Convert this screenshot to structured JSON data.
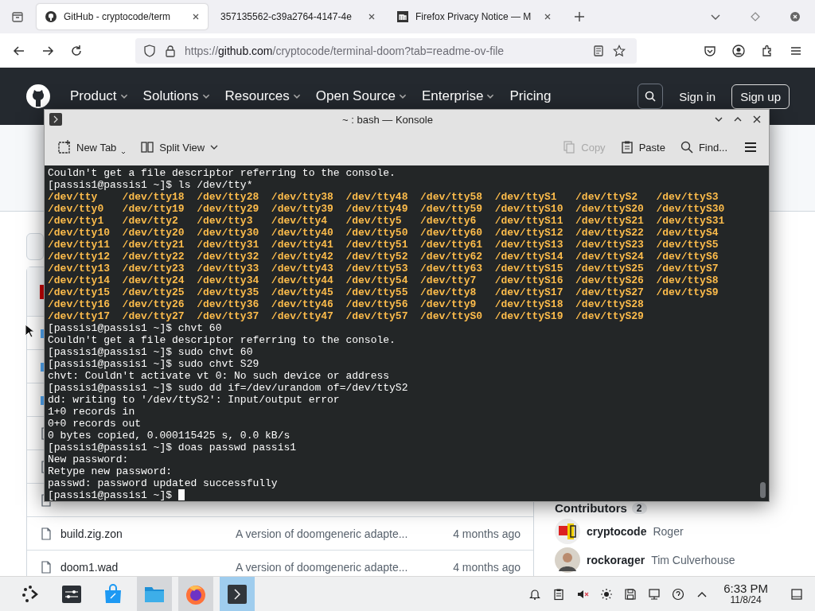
{
  "browser": {
    "tabs": [
      {
        "title": "GitHub - cryptocode/term",
        "selected": true
      },
      {
        "title": "357135562-c39a2764-4147-4e",
        "selected": false
      },
      {
        "title": "Firefox Privacy Notice — M",
        "selected": false
      }
    ],
    "url": {
      "scheme": "https://",
      "host": "github.com",
      "path": "/cryptocode/terminal-doom?tab=readme-ov-file"
    }
  },
  "github": {
    "nav": [
      {
        "label": "Product",
        "has_menu": true
      },
      {
        "label": "Solutions",
        "has_menu": true
      },
      {
        "label": "Resources",
        "has_menu": true
      },
      {
        "label": "Open Source",
        "has_menu": true
      },
      {
        "label": "Enterprise",
        "has_menu": true
      },
      {
        "label": "Pricing",
        "has_menu": false
      }
    ],
    "sign_in": "Sign in",
    "sign_up": "Sign up",
    "files": [
      {
        "kind": "avatar"
      },
      {
        "kind": "folder"
      },
      {
        "kind": "folder"
      },
      {
        "kind": "folder"
      },
      {
        "kind": "file"
      },
      {
        "kind": "file"
      },
      {
        "kind": "file"
      },
      {
        "kind": "file",
        "name": "build.zig.zon",
        "message": "A version of doomgeneric adapte...",
        "time": "4 months ago"
      },
      {
        "kind": "file",
        "name": "doom1.wad",
        "message": "A version of doomgeneric adapte...",
        "time": "4 months ago"
      }
    ],
    "contributors_title": "Contributors",
    "contributors_count": "2",
    "contributors": [
      {
        "login": "cryptocode",
        "name": "Roger"
      },
      {
        "login": "rockorager",
        "name": "Tim Culverhouse"
      }
    ]
  },
  "konsole": {
    "title": "~ : bash — Konsole",
    "toolbar": [
      {
        "label": "New Tab",
        "kind": "newtab",
        "disabled": false
      },
      {
        "label": "Split View",
        "kind": "split",
        "disabled": false
      },
      {
        "label": "Copy",
        "kind": "copy",
        "disabled": true
      },
      {
        "label": "Paste",
        "kind": "paste",
        "disabled": false
      },
      {
        "label": "Find...",
        "kind": "find",
        "disabled": false
      }
    ],
    "lines": [
      {
        "kind": "text",
        "text": "Couldn't get a file descriptor referring to the console."
      },
      {
        "kind": "text",
        "text": "[passis1@passis1 ~]$ ls /dev/tty*"
      },
      {
        "kind": "listing",
        "entries": [
          "/dev/tty",
          "/dev/tty18",
          "/dev/tty28",
          "/dev/tty38",
          "/dev/tty48",
          "/dev/tty58",
          "/dev/ttyS1",
          "/dev/ttyS2",
          "/dev/ttyS3"
        ]
      },
      {
        "kind": "listing",
        "entries": [
          "/dev/tty0",
          "/dev/tty19",
          "/dev/tty29",
          "/dev/tty39",
          "/dev/tty49",
          "/dev/tty59",
          "/dev/ttyS10",
          "/dev/ttyS20",
          "/dev/ttyS30"
        ]
      },
      {
        "kind": "listing",
        "entries": [
          "/dev/tty1",
          "/dev/tty2",
          "/dev/tty3",
          "/dev/tty4",
          "/dev/tty5",
          "/dev/tty6",
          "/dev/ttyS11",
          "/dev/ttyS21",
          "/dev/ttyS31"
        ]
      },
      {
        "kind": "listing",
        "entries": [
          "/dev/tty10",
          "/dev/tty20",
          "/dev/tty30",
          "/dev/tty40",
          "/dev/tty50",
          "/dev/tty60",
          "/dev/ttyS12",
          "/dev/ttyS22",
          "/dev/ttyS4"
        ]
      },
      {
        "kind": "listing",
        "entries": [
          "/dev/tty11",
          "/dev/tty21",
          "/dev/tty31",
          "/dev/tty41",
          "/dev/tty51",
          "/dev/tty61",
          "/dev/ttyS13",
          "/dev/ttyS23",
          "/dev/ttyS5"
        ]
      },
      {
        "kind": "listing",
        "entries": [
          "/dev/tty12",
          "/dev/tty22",
          "/dev/tty32",
          "/dev/tty42",
          "/dev/tty52",
          "/dev/tty62",
          "/dev/ttyS14",
          "/dev/ttyS24",
          "/dev/ttyS6"
        ]
      },
      {
        "kind": "listing",
        "entries": [
          "/dev/tty13",
          "/dev/tty23",
          "/dev/tty33",
          "/dev/tty43",
          "/dev/tty53",
          "/dev/tty63",
          "/dev/ttyS15",
          "/dev/ttyS25",
          "/dev/ttyS7"
        ]
      },
      {
        "kind": "listing",
        "entries": [
          "/dev/tty14",
          "/dev/tty24",
          "/dev/tty34",
          "/dev/tty44",
          "/dev/tty54",
          "/dev/tty7",
          "/dev/ttyS16",
          "/dev/ttyS26",
          "/dev/ttyS8"
        ]
      },
      {
        "kind": "listing",
        "entries": [
          "/dev/tty15",
          "/dev/tty25",
          "/dev/tty35",
          "/dev/tty45",
          "/dev/tty55",
          "/dev/tty8",
          "/dev/ttyS17",
          "/dev/ttyS27",
          "/dev/ttyS9"
        ]
      },
      {
        "kind": "listing",
        "entries": [
          "/dev/tty16",
          "/dev/tty26",
          "/dev/tty36",
          "/dev/tty46",
          "/dev/tty56",
          "/dev/tty9",
          "/dev/ttyS18",
          "/dev/ttyS28"
        ]
      },
      {
        "kind": "listing",
        "entries": [
          "/dev/tty17",
          "/dev/tty27",
          "/dev/tty37",
          "/dev/tty47",
          "/dev/tty57",
          "/dev/ttyS0",
          "/dev/ttyS19",
          "/dev/ttyS29"
        ]
      },
      {
        "kind": "text",
        "text": "[passis1@passis1 ~]$ chvt 60"
      },
      {
        "kind": "text",
        "text": "Couldn't get a file descriptor referring to the console."
      },
      {
        "kind": "text",
        "text": "[passis1@passis1 ~]$ sudo chvt 60"
      },
      {
        "kind": "text",
        "text": "[passis1@passis1 ~]$ sudo chvt S29"
      },
      {
        "kind": "text",
        "text": "chvt: Couldn't activate vt 0: No such device or address"
      },
      {
        "kind": "text",
        "text": "[passis1@passis1 ~]$ sudo dd if=/dev/urandom of=/dev/ttyS2"
      },
      {
        "kind": "text",
        "text": "dd: writing to '/dev/ttyS2': Input/output error"
      },
      {
        "kind": "text",
        "text": "1+0 records in"
      },
      {
        "kind": "text",
        "text": "0+0 records out"
      },
      {
        "kind": "text",
        "text": "0 bytes copied, 0.000115425 s, 0.0 kB/s"
      },
      {
        "kind": "text",
        "text": "[passis1@passis1 ~]$ doas passwd passis1"
      },
      {
        "kind": "text",
        "text": "New password:"
      },
      {
        "kind": "text",
        "text": "Retype new password:"
      },
      {
        "kind": "text",
        "text": "passwd: password updated successfully"
      },
      {
        "kind": "text",
        "text": "[passis1@passis1 ~]$"
      }
    ],
    "cursor": true
  },
  "taskbar": {
    "apps": [
      {
        "kind": "launcher",
        "running": false,
        "selected": false
      },
      {
        "kind": "settings",
        "running": false,
        "selected": false
      },
      {
        "kind": "store",
        "running": false,
        "selected": false
      },
      {
        "kind": "files",
        "running": true,
        "selected": false
      },
      {
        "kind": "firefox",
        "running": true,
        "selected": false
      },
      {
        "kind": "konsole",
        "running": true,
        "selected": true
      }
    ],
    "time": "6:33 PM",
    "date": "11/8/24"
  }
}
